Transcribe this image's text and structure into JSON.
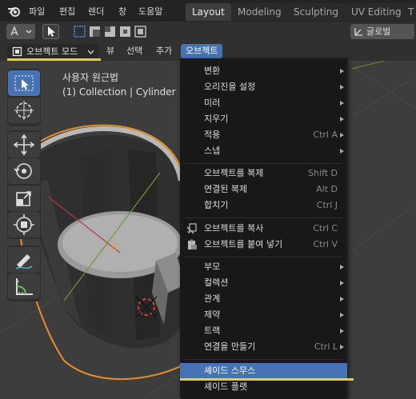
{
  "topbar": {
    "menus": [
      "파일",
      "편집",
      "렌더",
      "창",
      "도움말"
    ],
    "workspaces": [
      "Layout",
      "Modeling",
      "Sculpting",
      "UV Editing",
      "T"
    ],
    "active_workspace": "Layout"
  },
  "toolrow": {
    "orientation_label": "글로벌"
  },
  "header": {
    "mode_label": "오브젝트 모드",
    "menus": [
      "뷰",
      "선택",
      "추가",
      "오브젝트"
    ],
    "active_menu": "오브젝트"
  },
  "viewport": {
    "view_name": "사용자 원근법",
    "collection_info": "(1) Collection | Cylinder"
  },
  "object_menu": {
    "items": [
      {
        "label": "변환",
        "shortcut": "",
        "submenu": true
      },
      {
        "label": "오리진을 설정",
        "shortcut": "",
        "submenu": true
      },
      {
        "label": "미러",
        "shortcut": "",
        "submenu": true
      },
      {
        "label": "지우기",
        "shortcut": "",
        "submenu": true
      },
      {
        "label": "적용",
        "shortcut": "Ctrl A",
        "submenu": true
      },
      {
        "label": "스냅",
        "shortcut": "",
        "submenu": true
      },
      {
        "label": "오브젝트를 복제",
        "shortcut": "Shift D",
        "submenu": false
      },
      {
        "label": "연결된 복제",
        "shortcut": "Alt D",
        "submenu": false
      },
      {
        "label": "합치기",
        "shortcut": "Ctrl J",
        "submenu": false
      },
      {
        "label": "오브젝트를 복사",
        "shortcut": "Ctrl C",
        "submenu": false
      },
      {
        "label": "오브젝트를 붙여 넣기",
        "shortcut": "Ctrl V",
        "submenu": false
      },
      {
        "label": "부모",
        "shortcut": "",
        "submenu": true
      },
      {
        "label": "컬렉션",
        "shortcut": "",
        "submenu": true
      },
      {
        "label": "관계",
        "shortcut": "",
        "submenu": true
      },
      {
        "label": "제약",
        "shortcut": "",
        "submenu": true
      },
      {
        "label": "트랙",
        "shortcut": "",
        "submenu": true
      },
      {
        "label": "연결을 만들기",
        "shortcut": "Ctrl L",
        "submenu": true
      },
      {
        "label": "셰이드 스무스",
        "shortcut": "",
        "submenu": false
      },
      {
        "label": "셰이드 플랫",
        "shortcut": "",
        "submenu": false
      }
    ],
    "highlighted": "셰이드 스무스"
  },
  "colors": {
    "accent": "#4772b3",
    "highlight_underline": "#f0d21a",
    "selection_outline": "#e8902a"
  }
}
